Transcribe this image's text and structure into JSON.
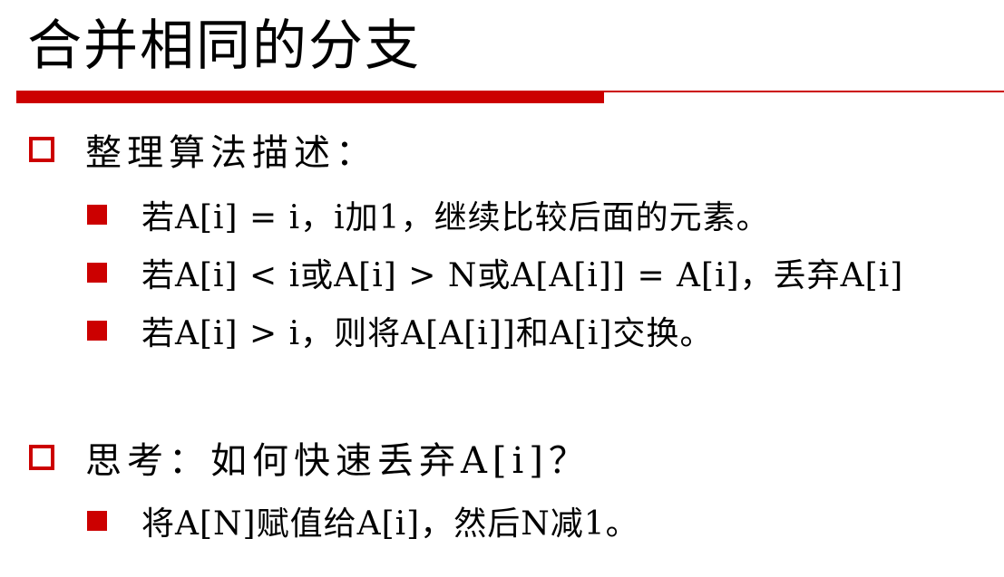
{
  "slide": {
    "title": "合并相同的分支",
    "colors": {
      "accent": "#cc0000",
      "text": "#000000",
      "background": "#ffffff"
    },
    "bullet_icons": {
      "level1": "hollow-square-icon",
      "level2": "filled-square-icon"
    },
    "sections": [
      {
        "heading": "整理算法描述：",
        "items": [
          "若A[i] = i，i加1，继续比较后面的元素。",
          "若A[i] < i或A[i] > N或A[A[i]] = A[i]，丢弃A[i]",
          "若A[i] > i，则将A[A[i]]和A[i]交换。"
        ]
      },
      {
        "heading": "思考：如何快速丢弃A[i]？",
        "items": [
          "将A[N]赋值给A[i]，然后N减1。"
        ]
      }
    ]
  }
}
